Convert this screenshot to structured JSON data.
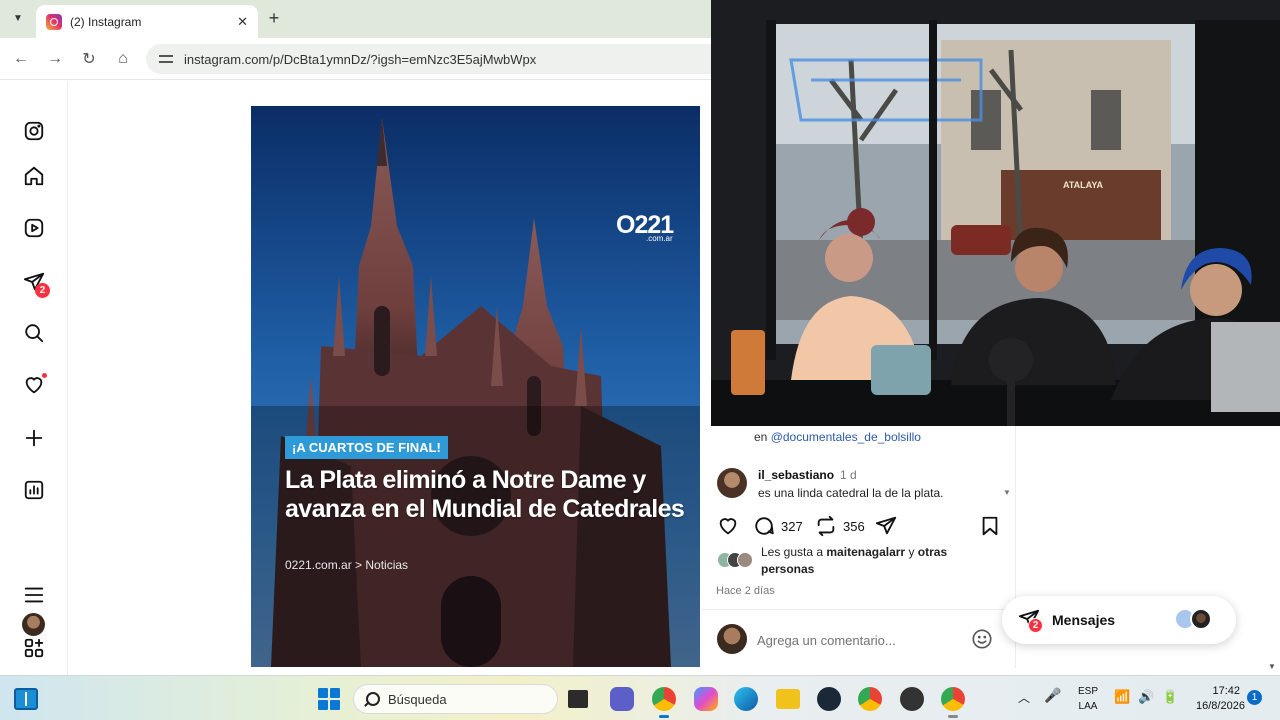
{
  "browser": {
    "tab_title": "(2) Instagram",
    "tab_close_glyph": "✕",
    "new_tab_glyph": "+",
    "url": "instagram.com/p/DcBta1ymnDz/?igsh=emNzc3E5ajMwbWpx"
  },
  "sidebar": {
    "items": [
      {
        "name": "instagram-logo-icon"
      },
      {
        "name": "home-icon"
      },
      {
        "name": "reels-icon"
      },
      {
        "name": "direct-messages-icon",
        "badge": "2"
      },
      {
        "name": "search-icon"
      },
      {
        "name": "notifications-heart-icon",
        "dot": true
      },
      {
        "name": "create-plus-icon"
      },
      {
        "name": "dashboard-icon"
      },
      {
        "name": "profile-avatar"
      },
      {
        "name": "more-menu-icon"
      },
      {
        "name": "also-from-meta-icon"
      }
    ]
  },
  "post": {
    "logo": "O221",
    "logo_sub": ".com.ar",
    "badge": "¡A CUARTOS DE FINAL!",
    "headline": "La Plata eliminó a Notre Dame y avanza en el Mundial de Catedrales",
    "source": "0221.com.ar > Noticias"
  },
  "panel": {
    "credit_prefix": "en",
    "credit_link": "@documentales_de_bolsillo",
    "comment": {
      "user": "il_sebastiano",
      "time": "1 d",
      "text": "es una linda catedral la de la plata."
    },
    "comments_count": "327",
    "reposts_count": "356",
    "likes_prefix": "Les gusta a",
    "likes_user": "maitenagalarr",
    "likes_mid": "y",
    "likes_others": "otras personas",
    "date": "Hace 2 días",
    "input_placeholder": "Agrega un comentario..."
  },
  "messages": {
    "label": "Mensajes",
    "badge": "2"
  },
  "webcam": {
    "sign_text": "ATALAYA"
  },
  "taskbar": {
    "search_placeholder": "Búsqueda",
    "lang_top": "ESP",
    "lang_bottom": "LAA",
    "time": "17:42",
    "date": "16/8/2026",
    "notifications": "1"
  },
  "colors": {
    "instagram_red": "#ff3040",
    "link_blue": "#2b5aa8",
    "badge_blue": "#2f9ad8",
    "windows_blue": "#0a78d4"
  }
}
